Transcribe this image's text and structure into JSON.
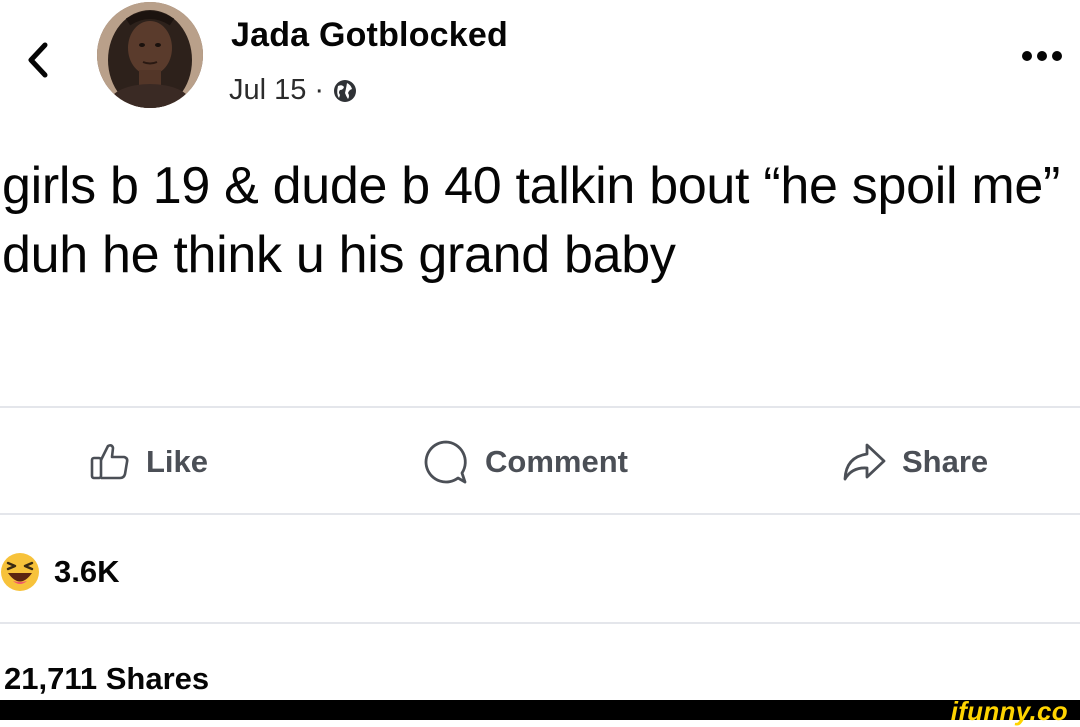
{
  "post": {
    "author": "Jada Gotblocked",
    "date": "Jul 15",
    "separator": "·",
    "privacy_icon": "globe-icon",
    "text": "girls b 19 & dude b 40 talkin bout “he spoil me” duh he think u his grand baby"
  },
  "header": {
    "back_icon": "chevron-left-icon",
    "more_icon": "more-dots-icon"
  },
  "actions": {
    "like": "Like",
    "comment": "Comment",
    "share": "Share"
  },
  "stats": {
    "reaction_icon": "haha-emoji-icon",
    "reaction_count": "3.6K",
    "shares": "21,711 Shares"
  },
  "watermark": "ifunny.co",
  "colors": {
    "text": "#050505",
    "muted": "#4b4f56",
    "divider": "#e4e6eb",
    "haha": "#f7c23a",
    "watermark": "#ffd400"
  }
}
